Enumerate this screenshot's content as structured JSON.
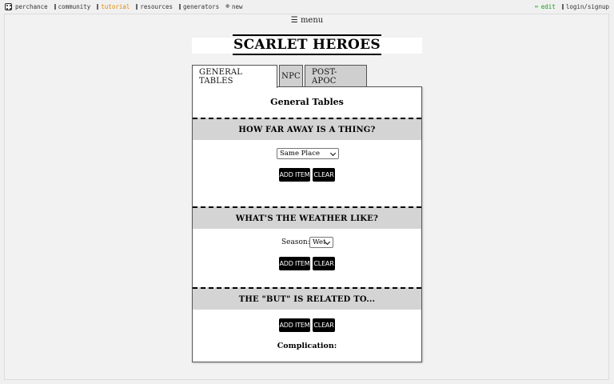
{
  "nav": {
    "left": [
      {
        "icon": "die-icon",
        "label": "perchance"
      },
      {
        "icon": "bar-icon",
        "label": "community"
      },
      {
        "icon": "bar-icon",
        "label": "tutorial",
        "color": "#e08a00"
      },
      {
        "icon": "bar-icon",
        "label": "resources"
      },
      {
        "icon": "bar-icon",
        "label": "generators"
      },
      {
        "icon": "plus-circle-icon",
        "glyph": "⊕",
        "label": "new"
      }
    ],
    "right": [
      {
        "icon": "pencil-icon",
        "glyph": "✏",
        "label": "edit",
        "color": "#1a9b1a"
      },
      {
        "icon": "bar-icon",
        "label": "login/signup"
      }
    ]
  },
  "menu": {
    "icon": "hamburger-icon",
    "glyph": "☰",
    "label": "menu"
  },
  "title": "SCARLET HEROES",
  "tabs": [
    {
      "label": "GENERAL TABLES",
      "active": true
    },
    {
      "label": "NPC",
      "active": false
    },
    {
      "label": "POST-APOC",
      "active": false
    }
  ],
  "panel": {
    "title": "General Tables",
    "sections": [
      {
        "heading": "HOW FAR AWAY IS A THING?",
        "select_value": "Same Place",
        "add_label": "ADD ITEM",
        "clear_label": "CLEAR"
      },
      {
        "heading": "WHAT'S THE WEATHER LIKE?",
        "select_label": "Season:",
        "select_value": "Wet",
        "add_label": "ADD ITEM",
        "clear_label": "CLEAR"
      },
      {
        "heading": "THE \"BUT\" IS RELATED TO...",
        "add_label": "ADD ITEM",
        "clear_label": "CLEAR",
        "result_label": "Complication:"
      }
    ]
  },
  "colors": {
    "accent_tutorial": "#e08a00",
    "accent_edit": "#1a9b1a",
    "section_bg": "#d4d4d4",
    "button_bg": "#000000"
  }
}
